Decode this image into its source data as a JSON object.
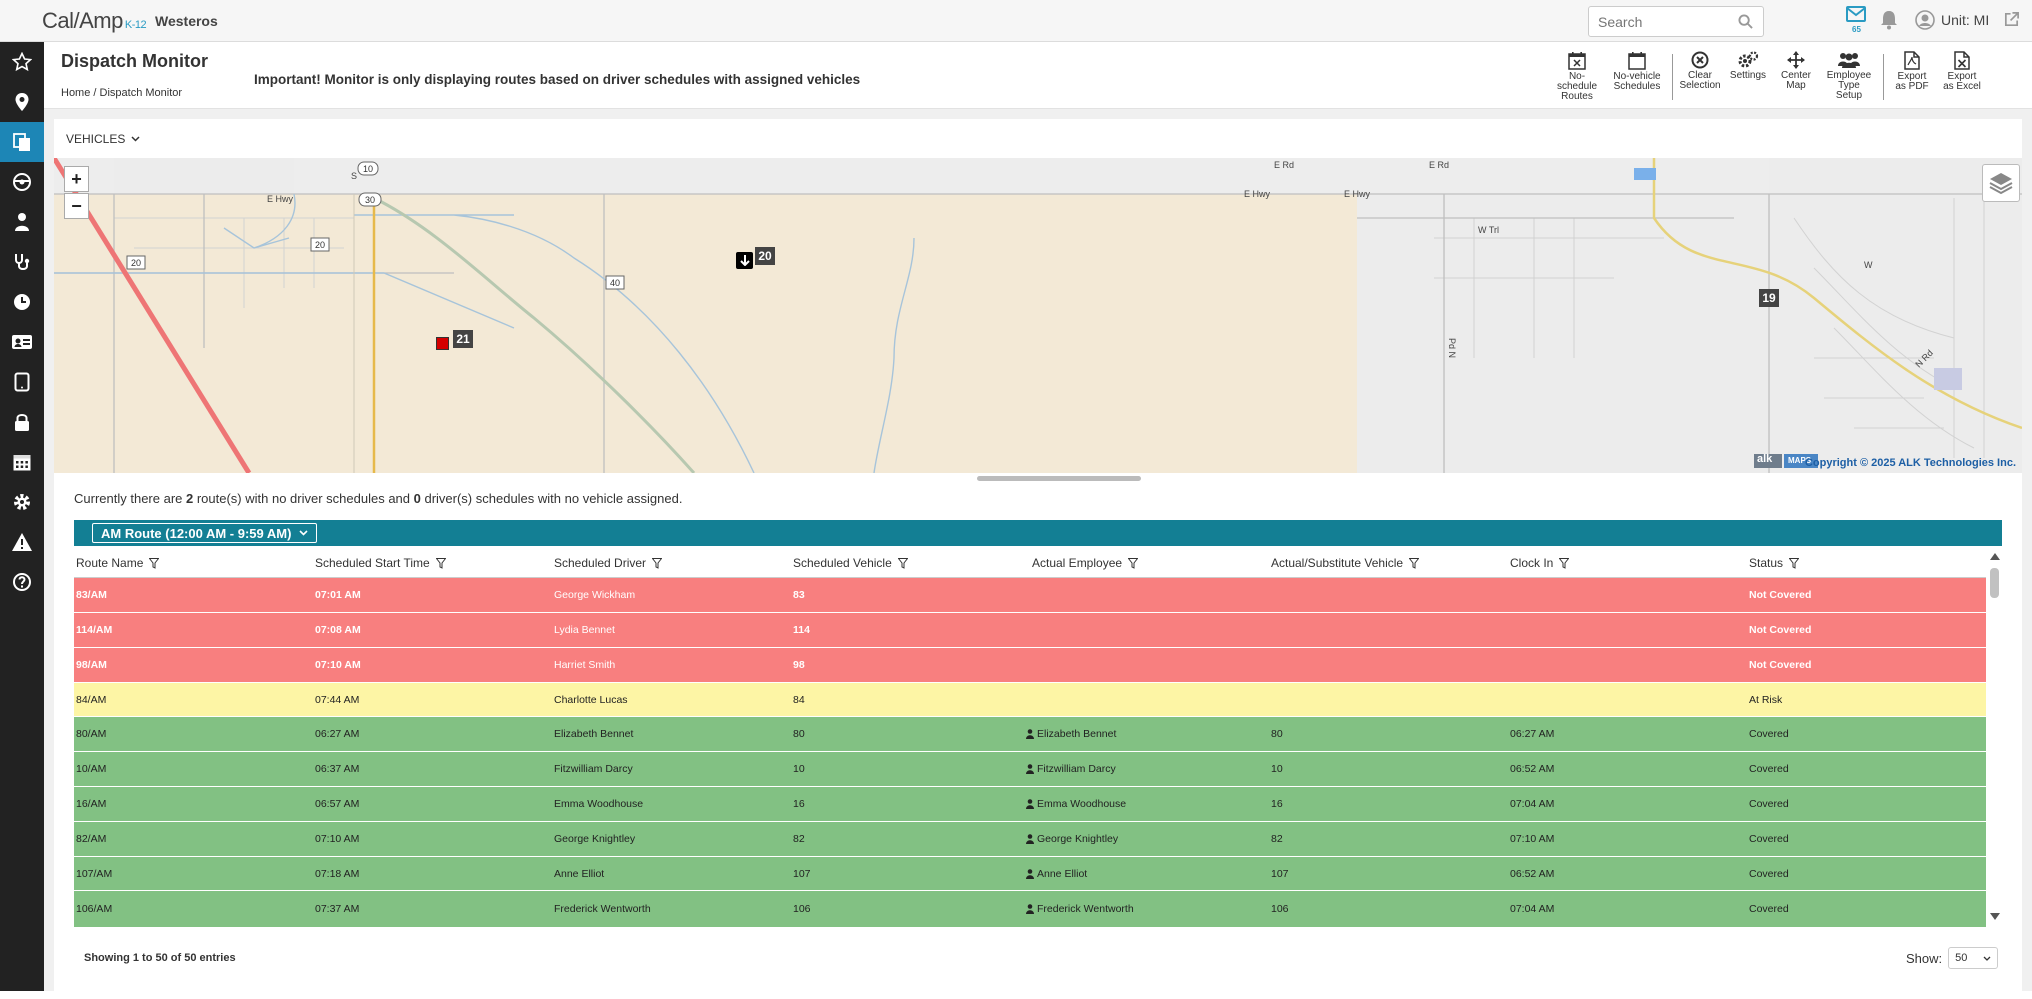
{
  "app": {
    "logo_text": "Cal/Amp",
    "logo_sub": "K-12",
    "district": "Westeros",
    "mail_count": "65",
    "user_label": "Unit: MI"
  },
  "search": {
    "placeholder": "Search"
  },
  "sidebar": {
    "items": [
      "favorites",
      "location",
      "dispatch",
      "vehicle",
      "student",
      "stethoscope",
      "clock",
      "id-card",
      "tablet",
      "lock",
      "calendar",
      "settings",
      "alert",
      "help"
    ],
    "active_index": 2
  },
  "page": {
    "title": "Dispatch Monitor",
    "breadcrumb": {
      "home": "Home",
      "current": "Dispatch Monitor",
      "separator": "/"
    },
    "notice": "Important! Monitor is only displaying routes based on driver schedules with assigned vehicles"
  },
  "toolbar": {
    "no_schedule_routes": [
      "No-schedule",
      "Routes"
    ],
    "no_vehicle_schedules": [
      "No-vehicle",
      "Schedules"
    ],
    "clear_selection": [
      "Clear",
      "Selection"
    ],
    "settings": [
      "Settings"
    ],
    "center_map": [
      "Center",
      "Map"
    ],
    "employee_type_setup": [
      "Employee",
      "Type Setup"
    ],
    "export_pdf": [
      "Export",
      "as PDF"
    ],
    "export_excel": [
      "Export",
      "as Excel"
    ]
  },
  "vehicles_dropdown": "VEHICLES",
  "map": {
    "zoom_in": "+",
    "zoom_out": "−",
    "copyright": "Copyright © 2025 ALK Technologies Inc.",
    "alk_logo": "alk",
    "maps_logo": "MAPS",
    "road_labels": [
      "E Hwy",
      "E Hwy",
      "E Hwy",
      "E Rd",
      "E Rd",
      "W Trl",
      "Pd N",
      "N Rd",
      "W",
      "S"
    ],
    "shields": [
      "10",
      "30",
      "20",
      "20",
      "40"
    ],
    "vehicles": [
      {
        "id": "20"
      },
      {
        "id": "19"
      },
      {
        "id": "21"
      }
    ]
  },
  "summary": {
    "prefix": "Currently there are ",
    "routes_count": "2",
    "middle": " route(s) with no driver schedules and ",
    "drivers_count": "0",
    "suffix": " driver(s) schedules with no vehicle assigned."
  },
  "route_selector": "AM Route (12:00 AM - 9:59 AM)",
  "columns": [
    "Route Name",
    "Scheduled Start Time",
    "Scheduled Driver",
    "Scheduled Vehicle",
    "Actual Employee",
    "Actual/Substitute Vehicle",
    "Clock In",
    "Status"
  ],
  "status_colors": {
    "Not Covered": "#f87f7f",
    "At Risk": "#fdf5a5",
    "Covered": "#82c183"
  },
  "rows": [
    {
      "route": "83/AM",
      "start": "07:01 AM",
      "driver": "George Wickham",
      "vehicle": "83",
      "employee": "",
      "actual_vehicle": "",
      "clock_in": "",
      "status": "Not Covered"
    },
    {
      "route": "114/AM",
      "start": "07:08 AM",
      "driver": "Lydia Bennet",
      "vehicle": "114",
      "employee": "",
      "actual_vehicle": "",
      "clock_in": "",
      "status": "Not Covered"
    },
    {
      "route": "98/AM",
      "start": "07:10 AM",
      "driver": "Harriet Smith",
      "vehicle": "98",
      "employee": "",
      "actual_vehicle": "",
      "clock_in": "",
      "status": "Not Covered"
    },
    {
      "route": "84/AM",
      "start": "07:44 AM",
      "driver": "Charlotte Lucas",
      "vehicle": "84",
      "employee": "",
      "actual_vehicle": "",
      "clock_in": "",
      "status": "At Risk"
    },
    {
      "route": "80/AM",
      "start": "06:27 AM",
      "driver": "Elizabeth Bennet",
      "vehicle": "80",
      "employee": "Elizabeth Bennet",
      "actual_vehicle": "80",
      "clock_in": "06:27 AM",
      "status": "Covered"
    },
    {
      "route": "10/AM",
      "start": "06:37 AM",
      "driver": "Fitzwilliam Darcy",
      "vehicle": "10",
      "employee": "Fitzwilliam Darcy",
      "actual_vehicle": "10",
      "clock_in": "06:52 AM",
      "status": "Covered"
    },
    {
      "route": "16/AM",
      "start": "06:57 AM",
      "driver": "Emma Woodhouse",
      "vehicle": "16",
      "employee": "Emma Woodhouse",
      "actual_vehicle": "16",
      "clock_in": "07:04 AM",
      "status": "Covered"
    },
    {
      "route": "82/AM",
      "start": "07:10 AM",
      "driver": "George Knightley",
      "vehicle": "82",
      "employee": "George Knightley",
      "actual_vehicle": "82",
      "clock_in": "07:10 AM",
      "status": "Covered"
    },
    {
      "route": "107/AM",
      "start": "07:18 AM",
      "driver": "Anne Elliot",
      "vehicle": "107",
      "employee": "Anne Elliot",
      "actual_vehicle": "107",
      "clock_in": "06:52 AM",
      "status": "Covered"
    },
    {
      "route": "106/AM",
      "start": "07:37 AM",
      "driver": "Frederick Wentworth",
      "vehicle": "106",
      "employee": "Frederick Wentworth",
      "actual_vehicle": "106",
      "clock_in": "07:04 AM",
      "status": "Covered"
    }
  ],
  "footer": {
    "entries": "Showing 1 to 50 of 50 entries",
    "show_label": "Show:",
    "show_value": "50"
  }
}
